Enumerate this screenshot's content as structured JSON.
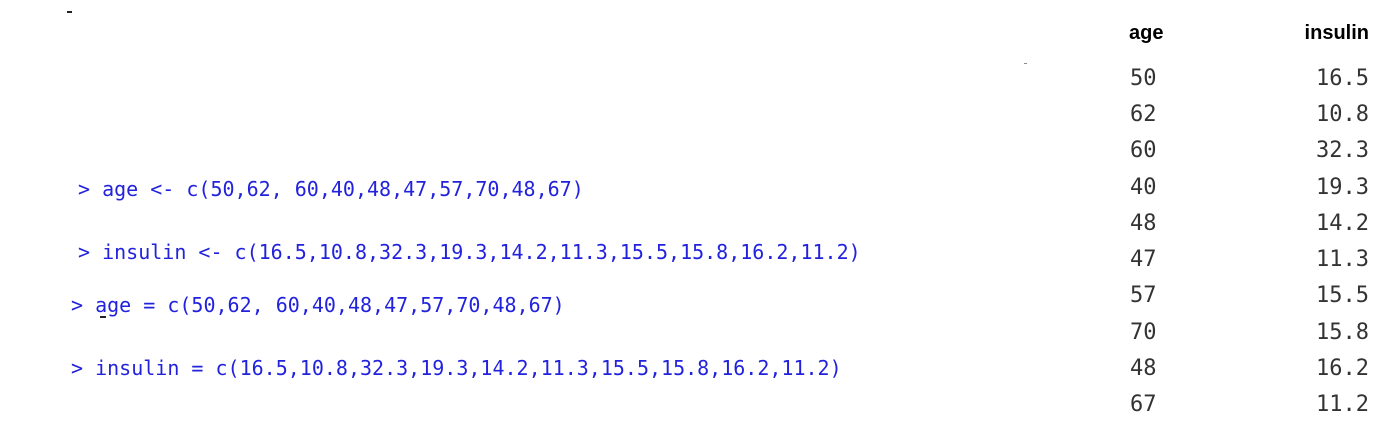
{
  "console": {
    "block1": [
      {
        "prompt": ">",
        "code": "age <- c(50,62, 60,40,48,47,57,70,48,67)"
      },
      {
        "prompt": ">",
        "code": "insulin <- c(16.5,10.8,32.3,19.3,14.2,11.3,15.5,15.8,16.2,11.2)"
      }
    ],
    "block2": [
      {
        "prompt": ">",
        "code": "age = c(50,62, 60,40,48,47,57,70,48,67)"
      },
      {
        "prompt": ">",
        "code": "insulin = c(16.5,10.8,32.3,19.3,14.2,11.3,15.5,15.8,16.2,11.2)"
      }
    ]
  },
  "table": {
    "headers": {
      "age": "age",
      "insulin": "insulin"
    },
    "rows": [
      {
        "age": "50",
        "insulin": "16.5"
      },
      {
        "age": "62",
        "insulin": "10.8"
      },
      {
        "age": "60",
        "insulin": "32.3"
      },
      {
        "age": "40",
        "insulin": "19.3"
      },
      {
        "age": "48",
        "insulin": "14.2"
      },
      {
        "age": "47",
        "insulin": "11.3"
      },
      {
        "age": "57",
        "insulin": "15.5"
      },
      {
        "age": "70",
        "insulin": "15.8"
      },
      {
        "age": "48",
        "insulin": "16.2"
      },
      {
        "age": "67",
        "insulin": "11.2"
      }
    ]
  },
  "colors": {
    "console_text": "#2222dd",
    "table_text": "#333333",
    "header_text": "#000000"
  }
}
